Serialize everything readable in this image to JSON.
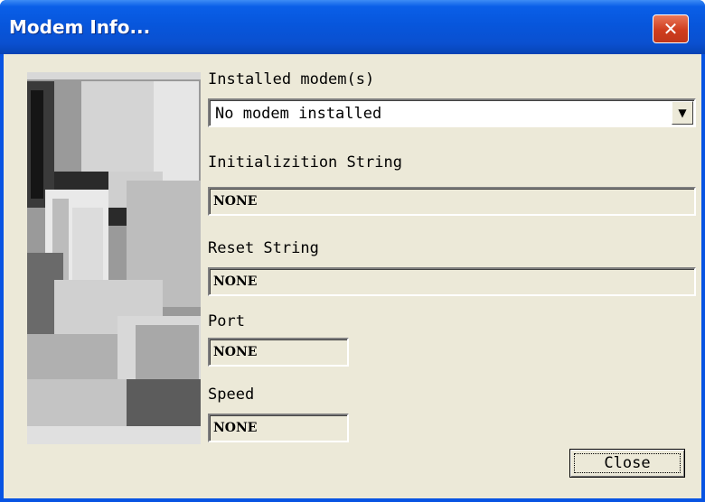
{
  "window": {
    "title": "Modem Info...",
    "close_icon": "close-icon"
  },
  "modem": {
    "label": "Installed modem(s)",
    "selected": "No modem installed"
  },
  "init": {
    "label": "Initializition String",
    "value": "NONE"
  },
  "reset": {
    "label": "Reset String",
    "value": "NONE"
  },
  "port": {
    "label": "Port",
    "value": "NONE"
  },
  "speed": {
    "label": "Speed",
    "value": "NONE"
  },
  "buttons": {
    "close": "Close"
  },
  "colors": {
    "titlebar": "#0756dc",
    "dialog_bg": "#ece9d8",
    "close_button": "#cf3d1e"
  }
}
